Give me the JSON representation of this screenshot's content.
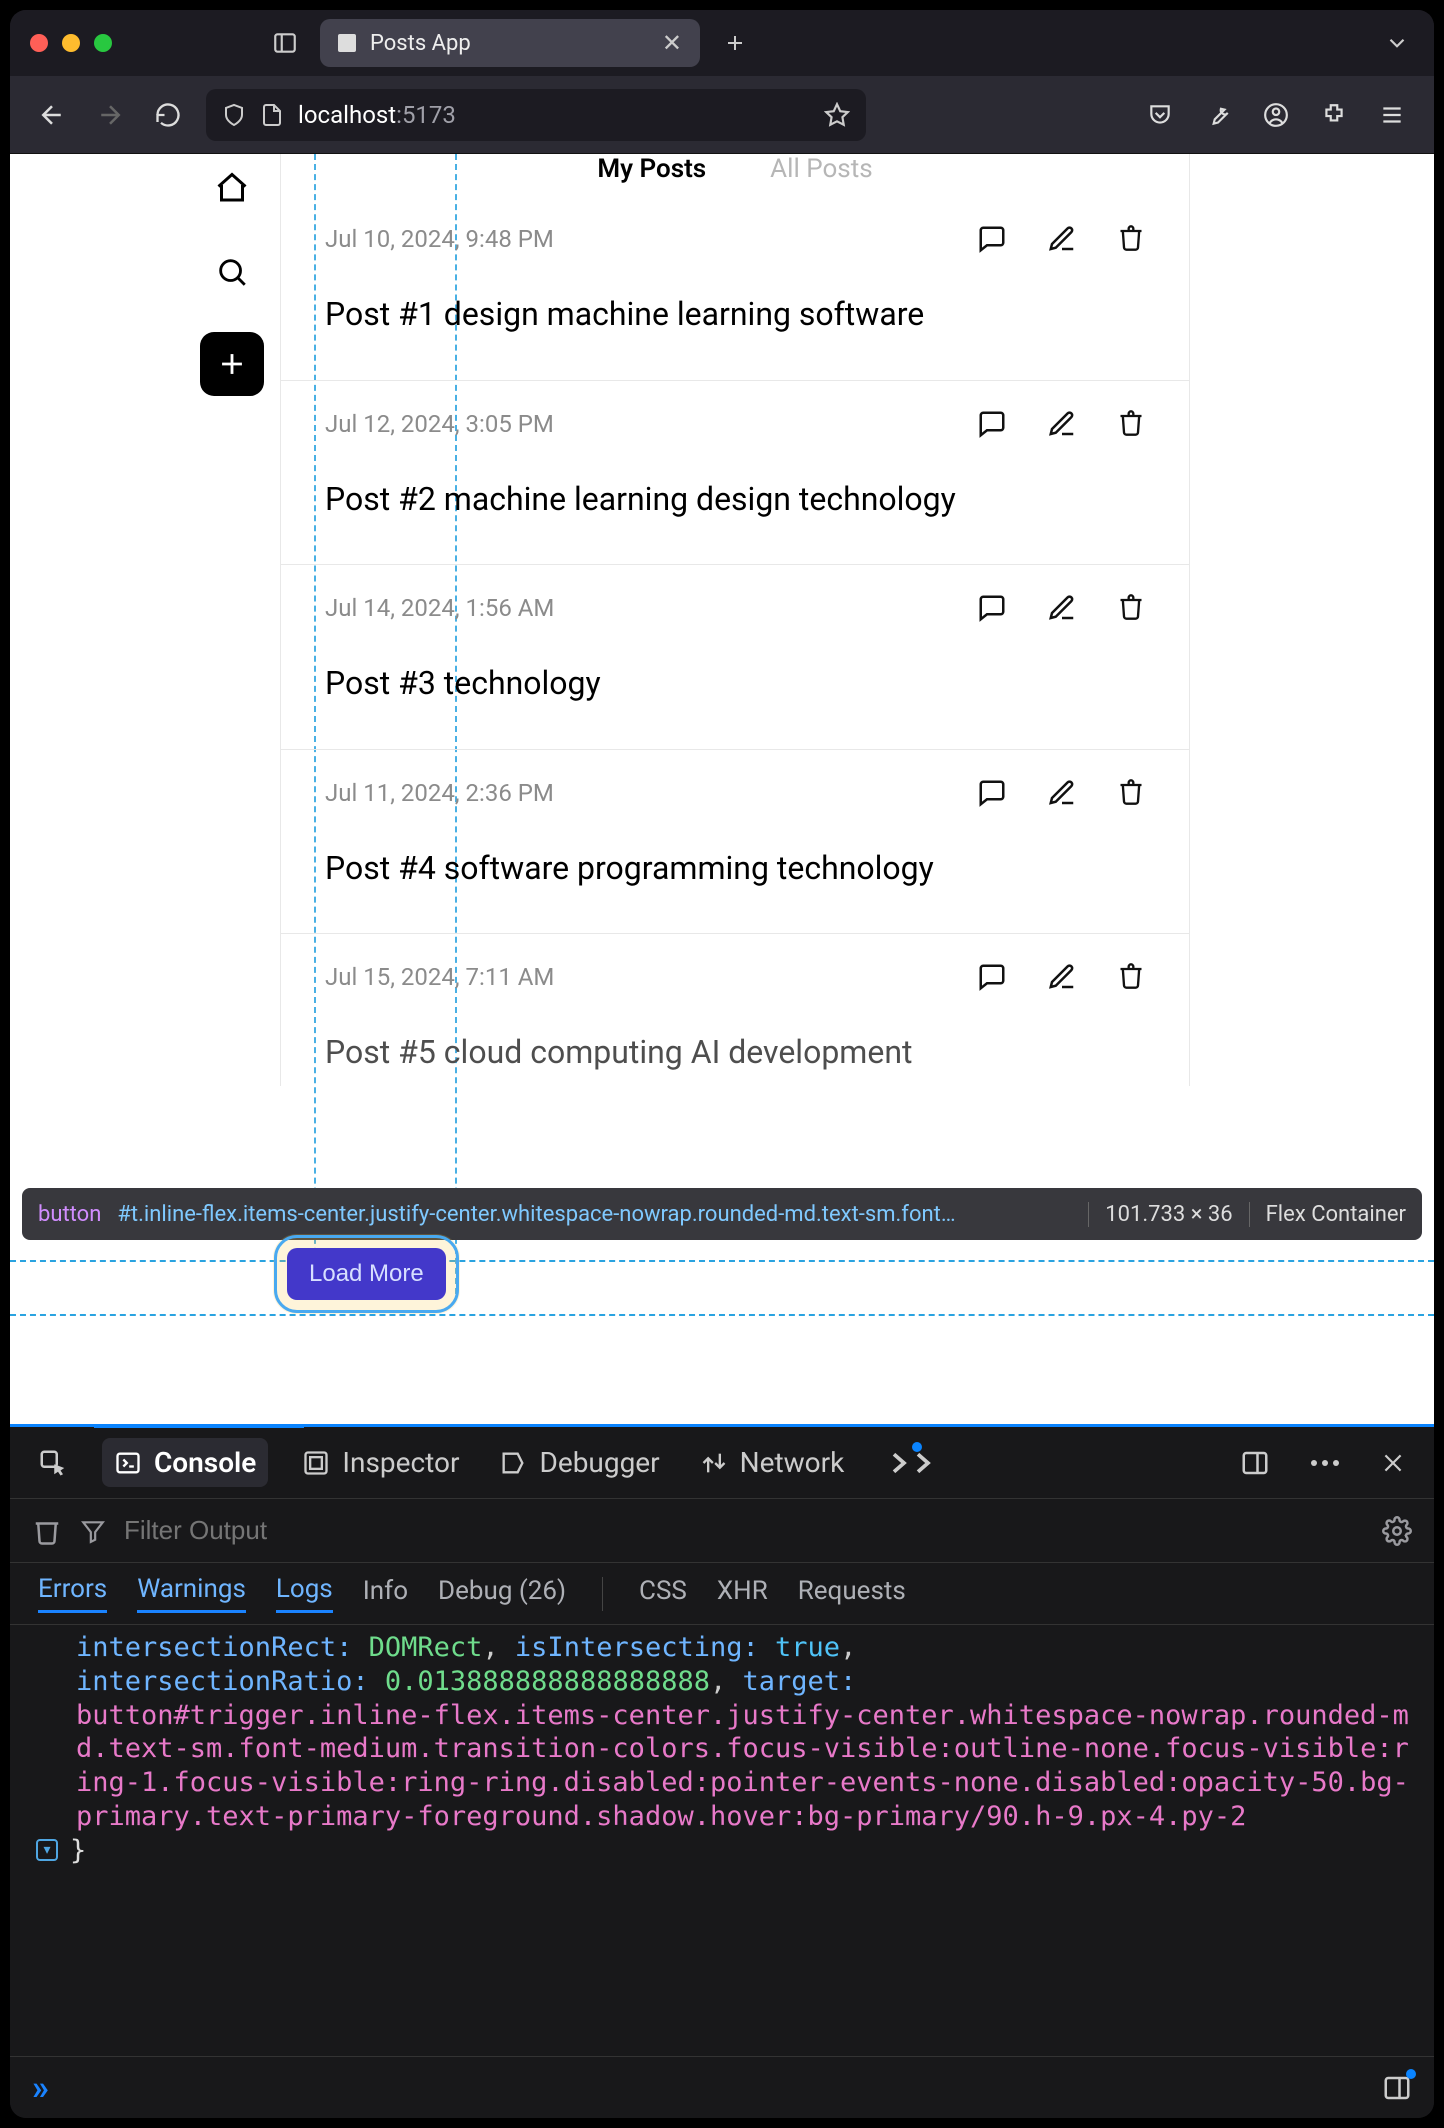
{
  "browser": {
    "tab_title": "Posts App",
    "url_host": "localhost",
    "url_port": ":5173"
  },
  "app": {
    "tabs": {
      "active": "My Posts",
      "inactive": "All Posts"
    },
    "posts": [
      {
        "date": "Jul 10, 2024, 9:48 PM",
        "title": "Post #1 design machine learning software"
      },
      {
        "date": "Jul 12, 2024, 3:05 PM",
        "title": "Post #2 machine learning design technology"
      },
      {
        "date": "Jul 14, 2024, 1:56 AM",
        "title": "Post #3 technology"
      },
      {
        "date": "Jul 11, 2024, 2:36 PM",
        "title": "Post #4 software programming technology"
      },
      {
        "date": "Jul 15, 2024, 7:11 AM",
        "title": "Post #5 cloud computing AI development"
      }
    ],
    "load_more": "Load More"
  },
  "inspector": {
    "tag": "button",
    "selector": "#t.inline-flex.items-center.justify-center.whitespace-nowrap.rounded-md.text-sm.font…",
    "dims": "101.733 × 36",
    "layout": "Flex Container"
  },
  "devtools": {
    "tabs": {
      "console": "Console",
      "inspector": "Inspector",
      "debugger": "Debugger",
      "network": "Network"
    },
    "filter_placeholder": "Filter Output",
    "cats": {
      "errors": "Errors",
      "warnings": "Warnings",
      "logs": "Logs",
      "info": "Info",
      "debug": "Debug (26)",
      "css": "CSS",
      "xhr": "XHR",
      "requests": "Requests"
    },
    "log": {
      "l1a": "intersectionRect:",
      "l1b": "DOMRect",
      "l1c": ", ",
      "l1d": "isIntersecting:",
      "l1e": "true",
      "l1f": ",",
      "l2a": "intersectionRatio:",
      "l2b": "0.013888888888888888",
      "l2c": ", ",
      "l2d": "target:",
      "sel": "button#trigger.inline-flex.items-center.justify-center.whitespace-nowrap.rounded-md.text-sm.font-medium.transition-colors.focus-visible:outline-none.focus-visible:ring-1.focus-visible:ring-ring.disabled:pointer-events-none.disabled:opacity-50.bg-primary.text-primary-foreground.shadow.hover:bg-primary/90.h-9.px-4.py-2",
      "close": "}"
    }
  }
}
